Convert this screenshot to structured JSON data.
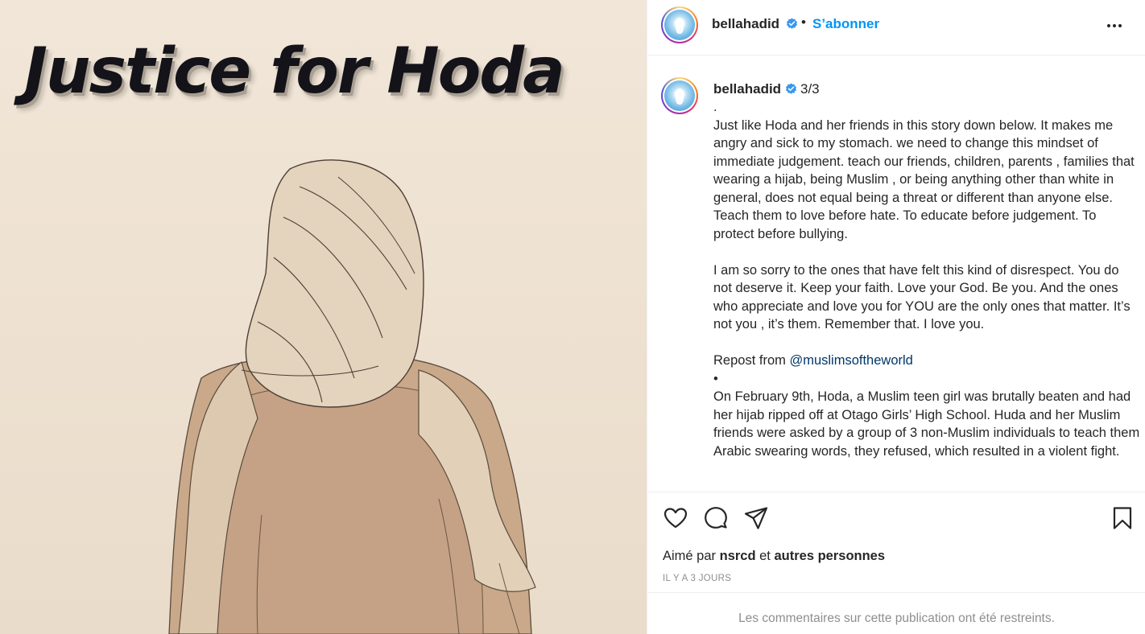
{
  "post_image": {
    "headline": "Justice for Hoda"
  },
  "header": {
    "username": "bellahadid",
    "separator": "•",
    "follow_label": "S’abonner",
    "more_icon": "more-horizontal-icon"
  },
  "caption": {
    "username": "bellahadid",
    "counter": "3/3",
    "paragraph_1": ".\nJust like Hoda and her friends in this story down below. It makes me angry and sick to my stomach. we need to change this mindset of immediate judgement. teach our friends, children, parents , families that wearing a hijab, being Muslim , or being anything other than white in general, does not equal being a threat or different than anyone else. Teach them to love before hate. To educate before judgement. To protect before bullying.",
    "paragraph_2": "I am so sorry to the ones that have felt this kind of disrespect. You do not deserve it. Keep your faith. Love your God. Be you. And the ones who appreciate and love you for YOU are the only ones that matter. It’s not you , it’s them. Remember that. I love you.",
    "repost_prefix": "Repost from ",
    "repost_mention": "@muslimsoftheworld",
    "bullet": "•",
    "paragraph_3": "On February 9th, Hoda, a Muslim teen girl was brutally beaten and had her hijab ripped off at Otago Girls’ High School. Huda and her Muslim friends were asked by a group of 3 non-Muslim individuals to teach them Arabic swearing words, they refused, which resulted in a violent fight."
  },
  "actions": {
    "like_icon": "heart-icon",
    "comment_icon": "comment-icon",
    "share_icon": "paper-plane-icon",
    "save_icon": "bookmark-icon",
    "liked_by_prefix": "Aimé par ",
    "liked_by_user": "nsrcd",
    "liked_by_and": " et ",
    "liked_by_others": "autres personnes",
    "timestamp": "IL Y A 3 JOURS"
  },
  "comments_restricted": "Les commentaires sur cette publication ont été restreints.",
  "colors": {
    "accent_blue": "#0095f6",
    "mention_blue": "#00376b",
    "muted_gray": "#8e8e8e",
    "image_background": "#efe4d5"
  }
}
